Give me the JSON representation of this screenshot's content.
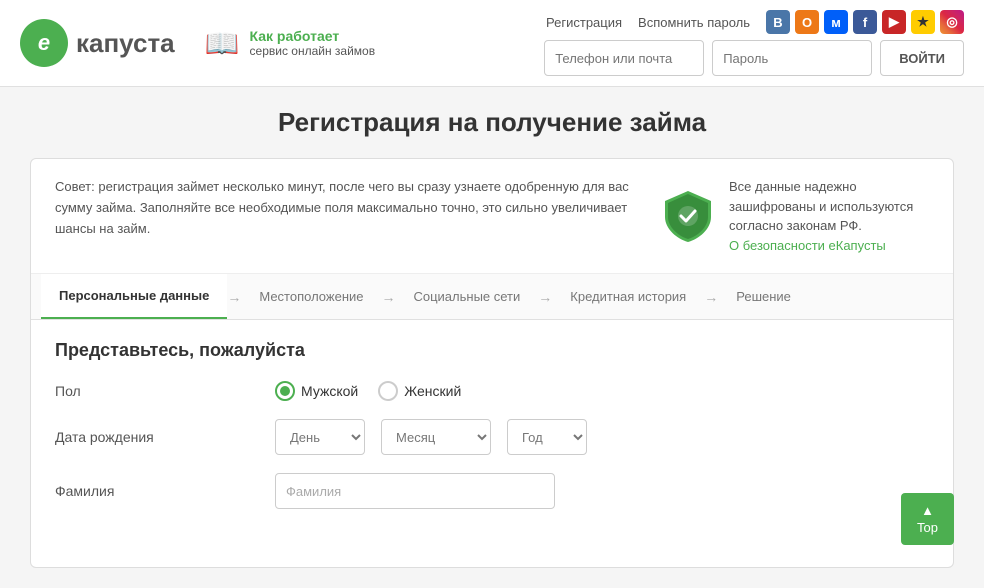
{
  "header": {
    "logo_letter": "е",
    "logo_text": "капуста",
    "how_it_works_line1": "Как работает",
    "how_it_works_line2": "сервис онлайн займов",
    "nav_register": "Регистрация",
    "nav_forgot": "Вспомнить пароль",
    "login_placeholder": "Телефон или почта",
    "password_placeholder": "Пароль",
    "login_btn": "ВОЙТИ"
  },
  "social_icons": [
    {
      "id": "vk",
      "label": "VK",
      "class": "si-vk",
      "symbol": "В"
    },
    {
      "id": "ok",
      "label": "OK",
      "class": "si-ok",
      "symbol": "О"
    },
    {
      "id": "mail",
      "label": "Mail",
      "class": "si-mail",
      "symbol": "м"
    },
    {
      "id": "fb",
      "label": "Facebook",
      "class": "si-fb",
      "symbol": "f"
    },
    {
      "id": "yt",
      "label": "YouTube",
      "class": "si-yt",
      "symbol": "▶"
    },
    {
      "id": "star",
      "label": "Star",
      "class": "si-star",
      "symbol": "★"
    },
    {
      "id": "inst",
      "label": "Instagram",
      "class": "si-inst",
      "symbol": "◎"
    }
  ],
  "page": {
    "title": "Регистрация на получение займа"
  },
  "info_banner": {
    "left_text": "Совет: регистрация займет несколько минут, после чего вы сразу узнаете одобренную для вас сумму займа. Заполняйте все необходимые поля максимально точно, это сильно увеличивает шансы на займ.",
    "right_text": "Все данные надежно зашифрованы и используются согласно законам РФ.",
    "security_link": "О безопасности еКапусты"
  },
  "tabs": [
    {
      "label": "Персональные данные",
      "active": true
    },
    {
      "label": "Местоположение",
      "active": false
    },
    {
      "label": "Социальные сети",
      "active": false
    },
    {
      "label": "Кредитная история",
      "active": false
    },
    {
      "label": "Решение",
      "active": false
    }
  ],
  "form": {
    "subtitle": "Представьтесь, пожалуйста",
    "gender_label": "Пол",
    "gender_options": [
      {
        "label": "Мужской",
        "selected": true
      },
      {
        "label": "Женский",
        "selected": false
      }
    ],
    "dob_label": "Дата рождения",
    "day_placeholder": "День",
    "month_placeholder": "Месяц",
    "year_placeholder": "Год",
    "lastname_label": "Фамилия",
    "lastname_placeholder": "Фамилия"
  },
  "scroll_top": {
    "label": "Top"
  }
}
